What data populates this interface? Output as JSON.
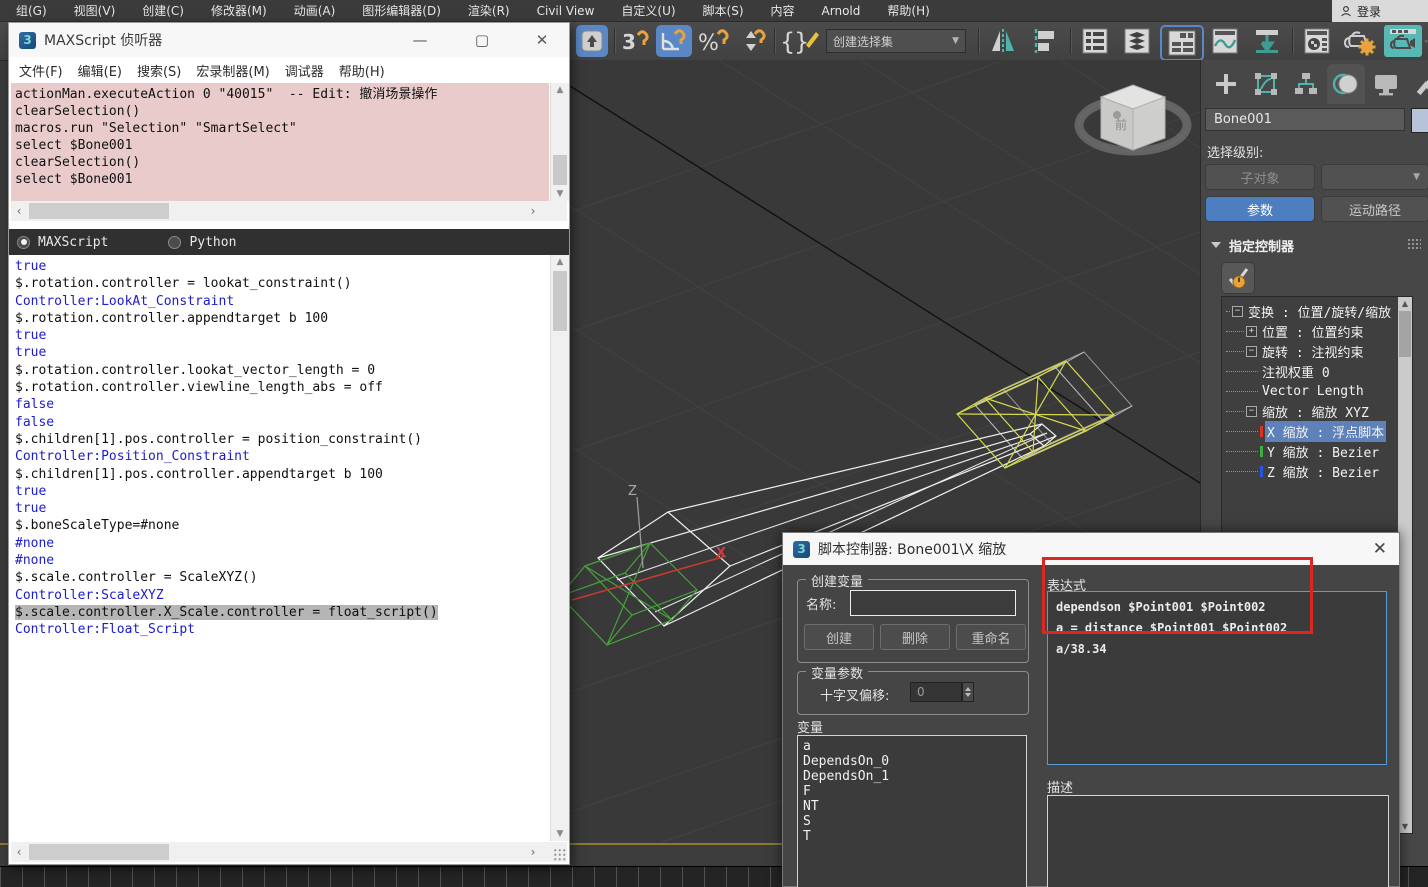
{
  "menu_bar": {
    "items": [
      "组(G)",
      "视图(V)",
      "创建(C)",
      "修改器(M)",
      "动画(A)",
      "图形编辑器(D)",
      "渲染(R)",
      "Civil View",
      "自定义(U)",
      "脚本(S)",
      "内容",
      "Arnold",
      "帮助(H)"
    ],
    "login_label": "登录"
  },
  "toolbar": {
    "selection_set_label": "创建选择集",
    "icons": [
      "up-arrow",
      "snaps-toggle-3d",
      "angle-snap",
      "percent-snap",
      "spinner-snap",
      "named-selection-sets",
      "mirror",
      "align",
      "layer-manager",
      "scene-explorer",
      "ribbon-toggle",
      "curve-editor",
      "schematic-view",
      "material-editor",
      "render-setup",
      "rendered-frame-window",
      "render-production"
    ]
  },
  "listener": {
    "title": "MAXScript 侦听器",
    "window_buttons": [
      "minimize",
      "maximize",
      "close"
    ],
    "menu_items": [
      "文件(F)",
      "编辑(E)",
      "搜索(S)",
      "宏录制器(M)",
      "调试器",
      "帮助(H)"
    ],
    "output_lines": [
      "actionMan.executeAction 0 \"40015\"  -- Edit: 撤消场景操作",
      "clearSelection()",
      "macros.run \"Selection\" \"SmartSelect\"",
      "select $Bone001",
      "clearSelection()",
      "select $Bone001"
    ],
    "lang_maxscript": "MAXScript",
    "lang_python": "Python",
    "code_lines": [
      {
        "t": "true",
        "c": "b"
      },
      {
        "t": "$.rotation.controller = lookat_constraint()",
        "c": "k"
      },
      {
        "t": "Controller:LookAt_Constraint",
        "c": "b"
      },
      {
        "t": "$.rotation.controller.appendtarget b 100",
        "c": "k"
      },
      {
        "t": "true",
        "c": "b"
      },
      {
        "t": "true",
        "c": "b"
      },
      {
        "t": "$.rotation.controller.lookat_vector_length = 0",
        "c": "k"
      },
      {
        "t": "$.rotation.controller.viewline_length_abs = off",
        "c": "k"
      },
      {
        "t": "false",
        "c": "b"
      },
      {
        "t": "false",
        "c": "b"
      },
      {
        "t": "$.children[1].pos.controller = position_constraint()",
        "c": "k"
      },
      {
        "t": "Controller:Position_Constraint",
        "c": "b"
      },
      {
        "t": "$.children[1].pos.controller.appendtarget b 100",
        "c": "k"
      },
      {
        "t": "true",
        "c": "b"
      },
      {
        "t": "true",
        "c": "b"
      },
      {
        "t": "$.boneScaleType=#none",
        "c": "k"
      },
      {
        "t": "#none",
        "c": "b"
      },
      {
        "t": "#none",
        "c": "b"
      },
      {
        "t": "$.scale.controller = ScaleXYZ()",
        "c": "k"
      },
      {
        "t": "Controller:ScaleXYZ",
        "c": "b"
      },
      {
        "t": "$.scale.controller.X_Scale.controller = float_script()",
        "c": "k",
        "sel": true
      },
      {
        "t": "Controller:Float_Script",
        "c": "b"
      }
    ]
  },
  "viewport": {
    "axis_x_label": "X",
    "axis_z_label": "Z",
    "viewcube_front_label": "前"
  },
  "command_panel": {
    "object_name": "Bone001",
    "selection_level_label": "选择级别:",
    "sub_object_label": "子对象",
    "parameters_label": "参数",
    "motion_paths_label": "运动路径",
    "assign_controller_label": "指定控制器",
    "tabs": [
      "create",
      "modify",
      "hierarchy",
      "motion",
      "display",
      "utilities"
    ],
    "active_tab": "motion",
    "tree": [
      {
        "ind": 0,
        "exp": "-",
        "label": "变换 : 位置/旋转/缩放"
      },
      {
        "ind": 1,
        "exp": "+",
        "label": "位置 : 位置约束"
      },
      {
        "ind": 1,
        "exp": "-",
        "label": "旋转 : 注视约束"
      },
      {
        "ind": 2,
        "label": "注视权重 0"
      },
      {
        "ind": 2,
        "label": "Vector Length"
      },
      {
        "ind": 1,
        "exp": "-",
        "label": "缩放 : 缩放 XYZ"
      },
      {
        "ind": 2,
        "tick": "#e03020",
        "label": "X 缩放 : 浮点脚本",
        "sel": true
      },
      {
        "ind": 2,
        "tick": "#3fae3f",
        "label": "Y 缩放 : Bezier"
      },
      {
        "ind": 2,
        "tick": "#2a55e0",
        "label": "Z 缩放 : Bezier"
      }
    ]
  },
  "dialog": {
    "title": "脚本控制器: Bone001\\X 缩放",
    "create_variable_group": "创建变量",
    "name_label": "名称:",
    "create_button": "创建",
    "delete_button": "删除",
    "rename_button": "重命名",
    "variable_params_group": "变量参数",
    "tick_offset_label": "十字叉偏移:",
    "tick_offset_value": "0",
    "variables_label": "变量",
    "variables": [
      "a",
      "DependsOn_0",
      "DependsOn_1",
      "F",
      "NT",
      "S",
      "T"
    ],
    "expression_label": "表达式",
    "expression_lines": [
      "dependson $Point001 $Point002",
      "a = distance $Point001 $Point002",
      "a/38.34"
    ],
    "description_label": "描述"
  },
  "colors": {
    "accent_blue": "#4d7ec0",
    "selection_blue": "#5d81b8",
    "annotation_red": "#dc2620",
    "listener_pink": "#e9cbcb",
    "teal_icon": "#4fb3a9",
    "orange_icon": "#e8a33d"
  }
}
